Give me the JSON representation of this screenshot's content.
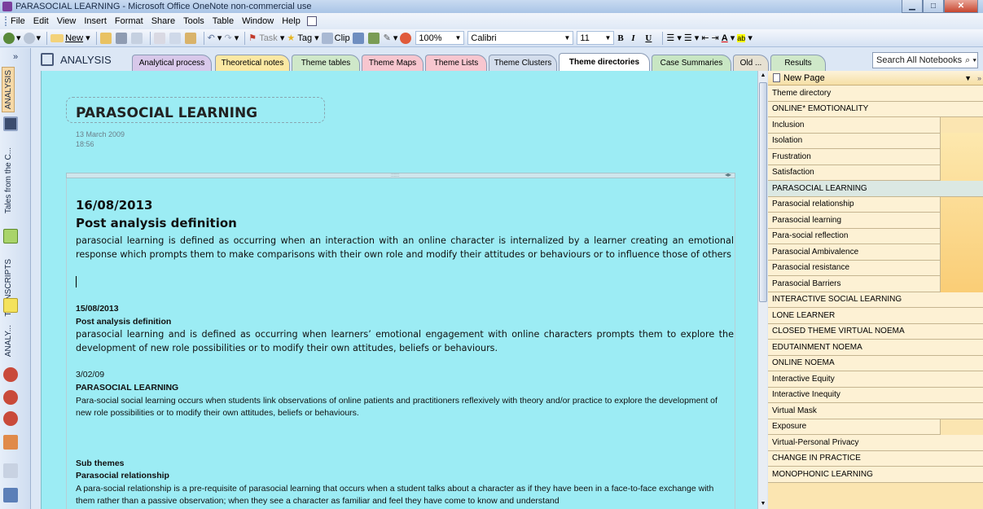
{
  "window": {
    "title": "PARASOCIAL LEARNING - Microsoft Office OneNote non-commercial use"
  },
  "menu": [
    "File",
    "Edit",
    "View",
    "Insert",
    "Format",
    "Share",
    "Tools",
    "Table",
    "Window",
    "Help"
  ],
  "toolbar": {
    "new_label": "New",
    "task_label": "Task",
    "tag_label": "Tag",
    "clip_label": "Clip",
    "zoom": "100%",
    "font": "Calibri",
    "font_size": "11"
  },
  "leftnav": {
    "collapse": "»",
    "notebooks": [
      "ANALYSIS",
      "Tales from the C...",
      "TRANSCRIPTS",
      "ANALY..."
    ]
  },
  "notebook": {
    "name": "ANALYSIS",
    "search_placeholder": "Search All Notebooks"
  },
  "sections": [
    {
      "label": "Analytical process",
      "color": "#d8c8ea"
    },
    {
      "label": "Theoretical notes",
      "color": "#fbe8a3"
    },
    {
      "label": "Theme tables",
      "color": "#cfe8c9"
    },
    {
      "label": "Theme Maps",
      "color": "#f7c6cf"
    },
    {
      "label": "Theme Lists",
      "color": "#f7c6cf"
    },
    {
      "label": "Theme Clusters",
      "color": "#d3ddec"
    },
    {
      "label": "Theme directories",
      "color": "#ffffff"
    },
    {
      "label": "Case Summaries",
      "color": "#c8e6c3"
    },
    {
      "label": "Old ...",
      "color": "#e6e1d2"
    },
    {
      "label": "Results",
      "color": "#cfe8c9"
    }
  ],
  "page": {
    "title": "PARASOCIAL LEARNING",
    "date": "13 March 2009",
    "time": "18:56",
    "entry1_date": "16/08/2013",
    "entry1_heading": "Post analysis definition",
    "entry1_text": "parasocial learning is defined as occurring when an interaction with an online character is internalized by a learner creating an emotional response which prompts them to make comparisons with their own role and modify their attitudes or behaviours or to influence those of others",
    "entry2_date": "15/08/2013",
    "entry2_heading": "Post analysis definition",
    "entry2_text": "parasocial learning and is defined as occurring when learners’ emotional engagement with online characters prompts them to explore the development of new role possibilities or to modify their own attitudes, beliefs or behaviours.",
    "entry3_date": "3/02/09",
    "entry3_heading": "PARASOCIAL LEARNING",
    "entry3_text": "Para-social social learning occurs when  students link observations of  online patients and practitioners reflexively with theory and/or practice to explore the development of new role possibilities or  to modify their own attitudes, beliefs or behaviours.",
    "subthemes_heading": "Sub themes",
    "subtheme1_heading": "Parasocial relationship",
    "subtheme1_text": "A para-social relationship is a pre-requisite of parasocial learning that occurs when a student talks about a character as if they have been in a face-to-face exchange with them rather than a passive observation; when they see a character as familiar and feel they have come to know and understand"
  },
  "pagelist": {
    "new_page": "New Page",
    "pages": [
      {
        "label": "Theme directory",
        "sub": false
      },
      {
        "label": "ONLINE* EMOTIONALITY",
        "sub": false
      },
      {
        "label": "Inclusion",
        "sub": true
      },
      {
        "label": "Isolation",
        "sub": true
      },
      {
        "label": "Frustration",
        "sub": true
      },
      {
        "label": "Satisfaction",
        "sub": true
      },
      {
        "label": "PARASOCIAL LEARNING",
        "sub": false,
        "current": true
      },
      {
        "label": "Parasocial relationship",
        "sub": true
      },
      {
        "label": "Parasocial learning",
        "sub": true
      },
      {
        "label": "Para-social reflection",
        "sub": true
      },
      {
        "label": "Parasocial Ambivalence",
        "sub": true
      },
      {
        "label": "Parasocial resistance",
        "sub": true
      },
      {
        "label": "Parasocial Barriers",
        "sub": true
      },
      {
        "label": "INTERACTIVE SOCIAL LEARNING",
        "sub": false
      },
      {
        "label": "LONE LEARNER",
        "sub": false
      },
      {
        "label": "CLOSED THEME VIRTUAL NOEMA",
        "sub": false
      },
      {
        "label": "EDUTAINMENT NOEMA",
        "sub": false
      },
      {
        "label": "ONLINE NOEMA",
        "sub": false
      },
      {
        "label": "Interactive Equity",
        "sub": false
      },
      {
        "label": "Interactive Inequity",
        "sub": false
      },
      {
        "label": "Virtual Mask",
        "sub": false
      },
      {
        "label": "Exposure",
        "sub": true
      },
      {
        "label": "Virtual-Personal Privacy",
        "sub": false
      },
      {
        "label": "CHANGE IN PRACTICE",
        "sub": false
      },
      {
        "label": "MONOPHONIC LEARNING",
        "sub": false
      }
    ]
  }
}
